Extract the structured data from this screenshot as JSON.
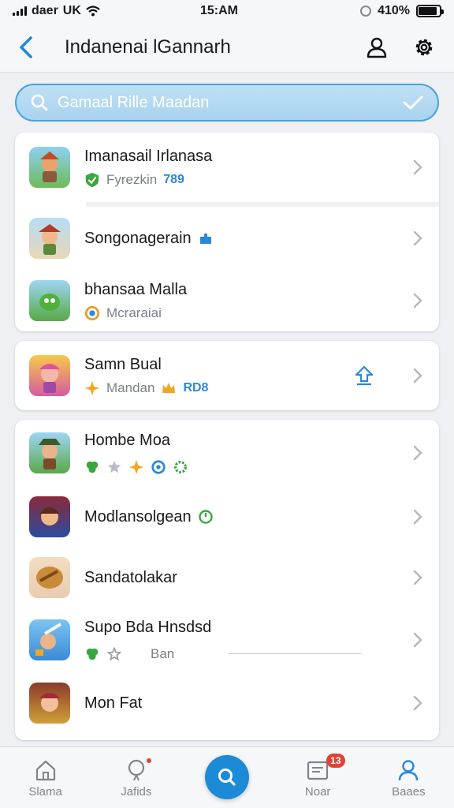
{
  "status_bar": {
    "carrier": "daer",
    "network": "UK",
    "time": "15:AM",
    "battery": "410%",
    "battery_level": 0.9
  },
  "header": {
    "title": "Indanenai lGannarh",
    "back_icon": "chevron-left-icon",
    "profile_icon": "user-icon",
    "settings_icon": "gear-icon"
  },
  "search": {
    "placeholder": "Gamaal Rille Maadan",
    "icon": "search-icon",
    "confirm_icon": "check-icon"
  },
  "card1": {
    "items": [
      {
        "title": "Imanasail Irlanasa",
        "subtitle": "Fyrezkin",
        "tag": "789",
        "sub_icon": "check-shield-icon"
      },
      {
        "title": "Songonagerain",
        "subtitle": "",
        "title_icon": "puzzle-icon"
      },
      {
        "title": "bhansaa Malla",
        "subtitle": "Mcraraiai",
        "sub_icon": "ring-icon"
      }
    ]
  },
  "card2": {
    "items": [
      {
        "title": "Samn Bual",
        "subtitle": "Mandan",
        "tag": "RD8",
        "action_icon": "upload-icon"
      }
    ]
  },
  "card3": {
    "items": [
      {
        "title": "Hombe Moa",
        "subtitle": "",
        "badge_icons": [
          "clover-icon",
          "star-icon",
          "sparkle-icon",
          "target-icon",
          "cog-green-icon"
        ]
      },
      {
        "title": "Modlansolgean",
        "subtitle": "",
        "title_icon": "clock-icon"
      },
      {
        "title": "Sandatolakar",
        "subtitle": ""
      },
      {
        "title": "Supo Bda Hnsdsd",
        "subtitle": "Ban",
        "badge_icons": [
          "clover-icon",
          "star-outline-icon"
        ]
      },
      {
        "title": "Mon Fat",
        "subtitle": ""
      }
    ]
  },
  "tabbar": {
    "tabs": [
      {
        "label": "Slama",
        "icon": "home-icon"
      },
      {
        "label": "Jafids",
        "icon": "balloon-icon"
      },
      {
        "label": "",
        "icon": "search-icon"
      },
      {
        "label": "Noar",
        "icon": "inbox-icon",
        "badge": "13"
      },
      {
        "label": "Baaes",
        "icon": "person-icon"
      }
    ]
  },
  "colors": {
    "accent": "#1c8ad6",
    "search_bg": "#bfe0f3",
    "badge": "#e04235"
  }
}
